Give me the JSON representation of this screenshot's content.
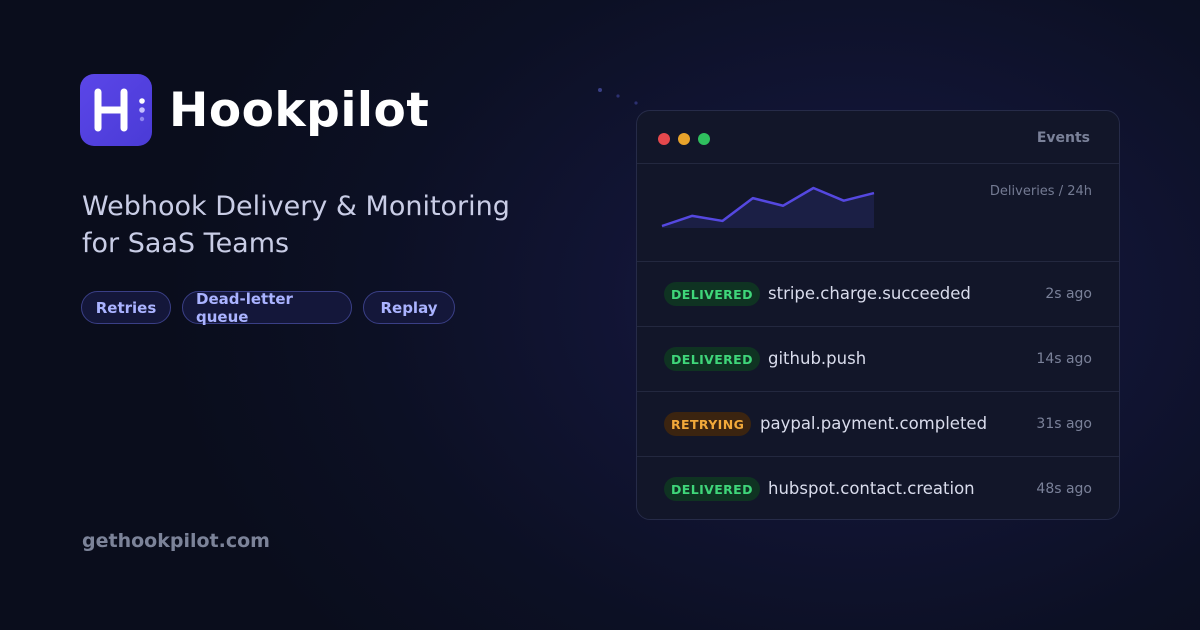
{
  "brand": {
    "name": "Hookpilot",
    "logo_icon": "h-hook-logo-icon",
    "accent": "#5b46e8"
  },
  "tagline": {
    "line1": "Webhook Delivery & Monitoring",
    "line2": "for SaaS Teams"
  },
  "features": [
    "Retries",
    "Dead-letter queue",
    "Replay"
  ],
  "website": "gethookpilot.com",
  "panel": {
    "title": "Events",
    "window_dots": [
      "#e5484d",
      "#e8a32b",
      "#2fbf5e"
    ],
    "chart_label": "Deliveries / 24h",
    "sparkline": {
      "type": "line",
      "values": [
        1,
        5,
        3,
        12,
        9,
        16,
        11,
        14
      ],
      "color": "#5548e0"
    },
    "events": [
      {
        "status": "DELIVERED",
        "status_color": "#3fd67a",
        "name": "stripe.charge.succeeded",
        "ago": "2s ago"
      },
      {
        "status": "DELIVERED",
        "status_color": "#3fd67a",
        "name": "github.push",
        "ago": "14s ago"
      },
      {
        "status": "RETRYING",
        "status_color": "#f2a93a",
        "name": "paypal.payment.completed",
        "ago": "31s ago"
      },
      {
        "status": "DELIVERED",
        "status_color": "#3fd67a",
        "name": "hubspot.contact.creation",
        "ago": "48s ago"
      }
    ]
  }
}
